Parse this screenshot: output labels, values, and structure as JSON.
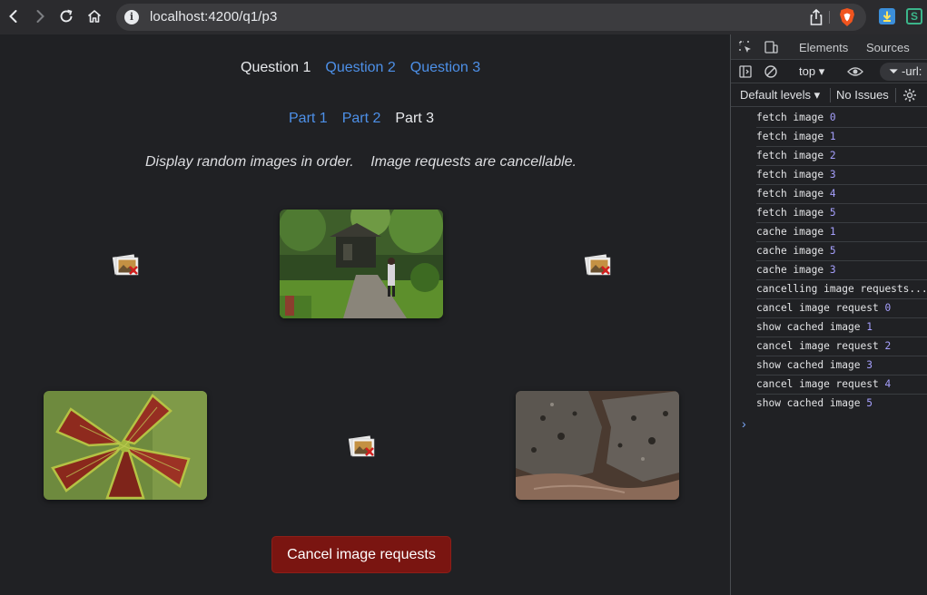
{
  "browser": {
    "url": "localhost:4200/q1/p3",
    "icons": {
      "back": "chevron-left-icon",
      "forward": "chevron-right-icon",
      "reload": "reload-icon",
      "home": "home-icon",
      "info": "info-icon",
      "share": "share-icon",
      "brave": "brave-shield-icon",
      "ext_download": "download-extension-icon",
      "ext_s": "s-extension-icon"
    },
    "ext_s_label": "S"
  },
  "page": {
    "question_nav": [
      {
        "label": "Question 1",
        "active": true
      },
      {
        "label": "Question 2",
        "active": false
      },
      {
        "label": "Question 3",
        "active": false
      }
    ],
    "part_nav": [
      {
        "label": "Part 1",
        "active": false
      },
      {
        "label": "Part 2",
        "active": false
      },
      {
        "label": "Part 3",
        "active": true
      }
    ],
    "description": [
      "Display random images in order.",
      "Image requests are cancellable."
    ],
    "images": [
      {
        "index": 0,
        "state": "broken"
      },
      {
        "index": 1,
        "state": "loaded",
        "subject": "garden path with person"
      },
      {
        "index": 2,
        "state": "broken"
      },
      {
        "index": 3,
        "state": "loaded",
        "subject": "red coleus leaves"
      },
      {
        "index": 4,
        "state": "broken"
      },
      {
        "index": 5,
        "state": "loaded",
        "subject": "rocks by water"
      }
    ],
    "cancel_button": "Cancel image requests",
    "colors": {
      "link": "#4d90e8",
      "button_bg": "#7a1511"
    }
  },
  "devtools": {
    "tabs": [
      "Elements",
      "Sources"
    ],
    "context": "top",
    "filter_text": "-url:",
    "levels": "Default levels",
    "issues": "No Issues",
    "logs": [
      {
        "text": "fetch image",
        "num": "0"
      },
      {
        "text": "fetch image",
        "num": "1"
      },
      {
        "text": "fetch image",
        "num": "2"
      },
      {
        "text": "fetch image",
        "num": "3"
      },
      {
        "text": "fetch image",
        "num": "4"
      },
      {
        "text": "fetch image",
        "num": "5"
      },
      {
        "text": "cache image",
        "num": "1"
      },
      {
        "text": "cache image",
        "num": "5"
      },
      {
        "text": "cache image",
        "num": "3"
      },
      {
        "text": "cancelling image requests...",
        "num": ""
      },
      {
        "text": "cancel image request",
        "num": "0"
      },
      {
        "text": "show cached image",
        "num": "1"
      },
      {
        "text": "cancel image request",
        "num": "2"
      },
      {
        "text": "show cached image",
        "num": "3"
      },
      {
        "text": "cancel image request",
        "num": "4"
      },
      {
        "text": "show cached image",
        "num": "5"
      }
    ],
    "prompt": "›"
  }
}
